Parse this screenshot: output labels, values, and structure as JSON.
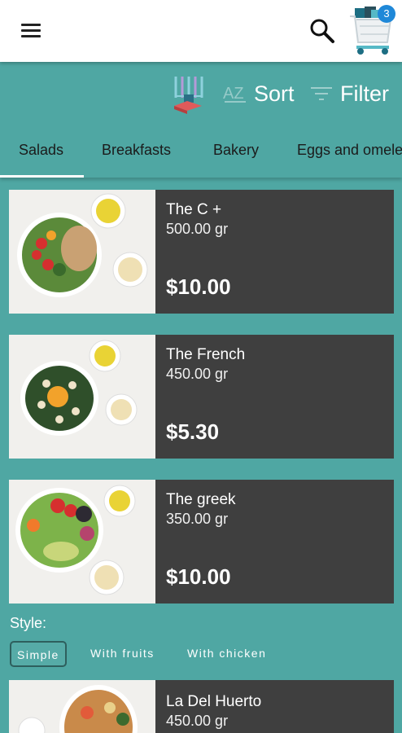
{
  "header": {
    "cart_count": "3"
  },
  "toolbar": {
    "sort_label": "Sort",
    "filter_label": "Filter"
  },
  "tabs": [
    {
      "label": "Salads"
    },
    {
      "label": "Breakfasts"
    },
    {
      "label": "Bakery"
    },
    {
      "label": "Eggs and omele"
    }
  ],
  "products": [
    {
      "name": "The C +",
      "weight": "500.00 gr",
      "price": "$10.00"
    },
    {
      "name": "The French",
      "weight": "450.00 gr",
      "price": "$5.30"
    },
    {
      "name": "The greek",
      "weight": "350.00 gr",
      "price": "$10.00"
    },
    {
      "name": "La Del Huerto",
      "weight": "450.00 gr",
      "price": ""
    }
  ],
  "style_filter": {
    "label": "Style:",
    "options": [
      {
        "label": "Simple"
      },
      {
        "label": "With fruits"
      },
      {
        "label": "With chicken"
      }
    ]
  },
  "colors": {
    "background": "#4fa7a3",
    "card": "#3f3f3f",
    "badge": "#1f88d8"
  }
}
